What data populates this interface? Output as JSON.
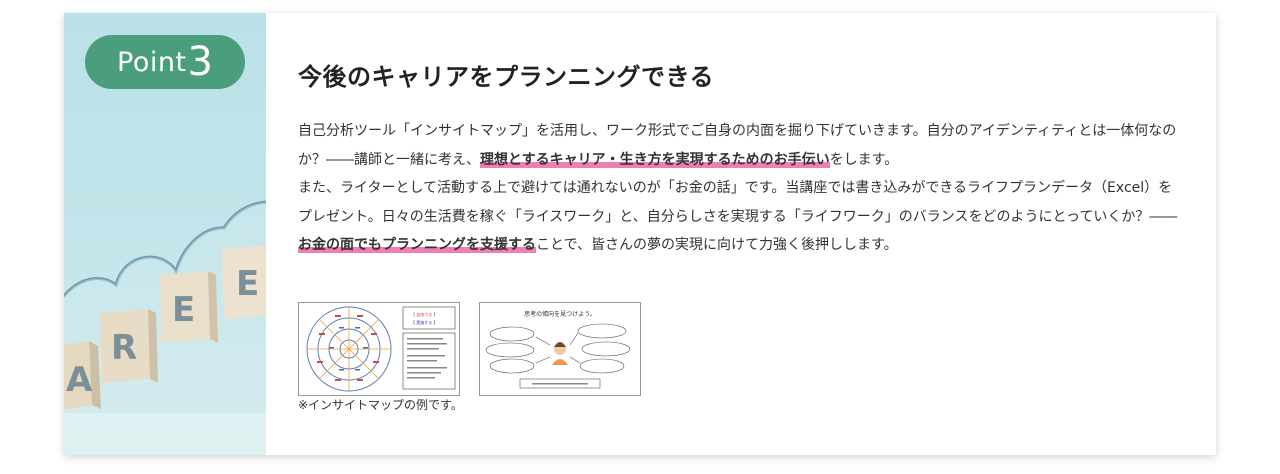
{
  "badge": {
    "word": "Point",
    "number": "3"
  },
  "heading": "今後のキャリアをプランニングできる",
  "paragraph": {
    "part1": "自己分析ツール「インサイトマップ」を活用し、ワーク形式でご自身の内面を掘り下げていきます。自分のアイデンティティとは一体何なのか？――講師と一緒に考え、",
    "highlight1": "理想とするキャリア・生き方を実現するためのお手伝い",
    "part2": "をします。",
    "part3": "また、ライターとして活動する上で避けては通れないのが「お金の話」です。当講座では書き込みができるライフプランデータ（Excel）をプレゼント。日々の生活費を稼ぐ「ライスワーク」と、自分らしさを実現する「ライフワーク」のバランスをどのようにとっていくか？――",
    "highlight2": "お金の面でもプランニングを支援する",
    "part4": "ことで、皆さんの夢の実現に向けて力強く後押しします。"
  },
  "images": {
    "insight_map_labels": [
      "【 自由でる 】",
      "【 実施する 】"
    ],
    "thinking_title": "思考の傾向を見つけよう。"
  },
  "caption": "※インサイトマップの例です。",
  "colors": {
    "badge": "#4a9d7d",
    "highlight": "#ee7fb4",
    "panel_bg": "#bfe3e8",
    "cloud_line": "#6f97aa"
  },
  "decor": {
    "block_letters": [
      "A",
      "R",
      "E",
      "E"
    ]
  }
}
